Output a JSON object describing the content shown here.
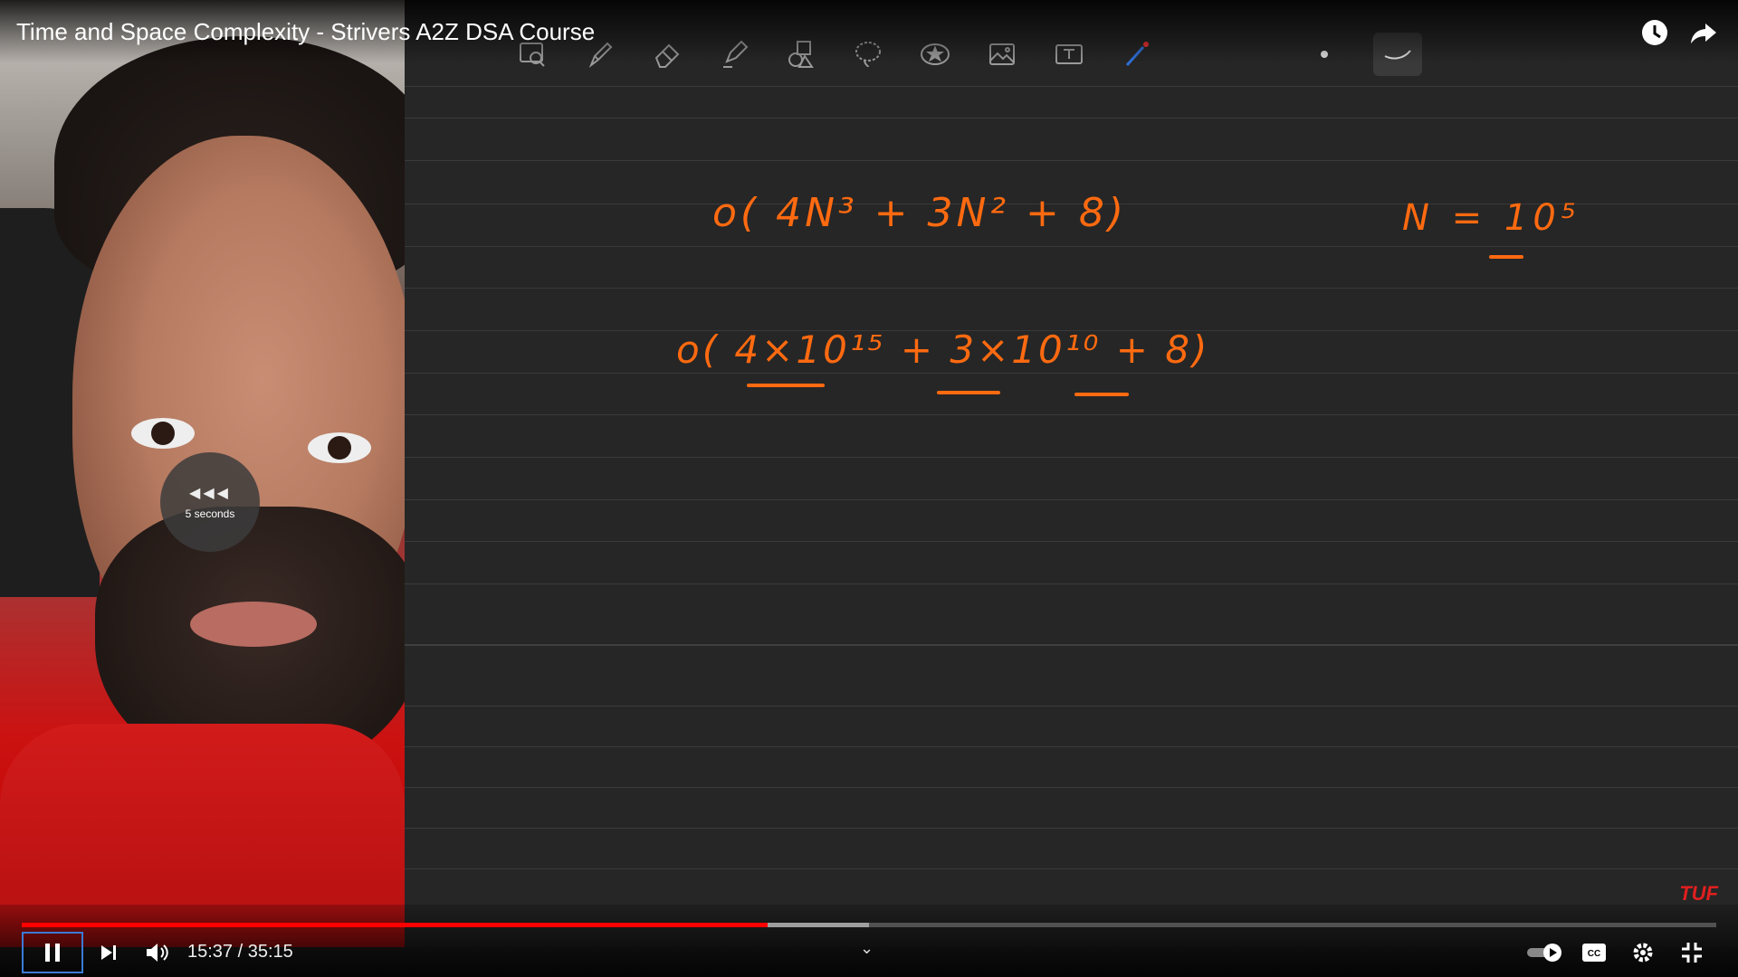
{
  "video": {
    "title": "Time and Space Complexity - Strivers A2Z DSA Course",
    "current_time": "15:37",
    "duration": "35:15",
    "time_display": "15:37 / 35:15",
    "progress_fraction": 0.44,
    "buffered_fraction": 0.5
  },
  "overlay": {
    "seek_label": "5 seconds",
    "seek_icon": "rewind-icon"
  },
  "board": {
    "line1": "o( 4N³ + 3N² + 8)",
    "line2": "N = 10⁵",
    "line3": "o( 4×10¹⁵ + 3×10¹⁰ + 8)",
    "watermark": "TUF",
    "ink_color": "#ff6a10"
  },
  "toolbar_tools": [
    "zoom-icon",
    "pen-icon",
    "eraser-icon",
    "highlighter-icon",
    "shapes-icon",
    "lasso-icon",
    "sticker-icon",
    "image-icon",
    "text-icon",
    "laser-icon"
  ],
  "colors": {
    "progress": "#ff0000",
    "focus": "#3a7bd5",
    "watermark": "#e01f1f"
  }
}
